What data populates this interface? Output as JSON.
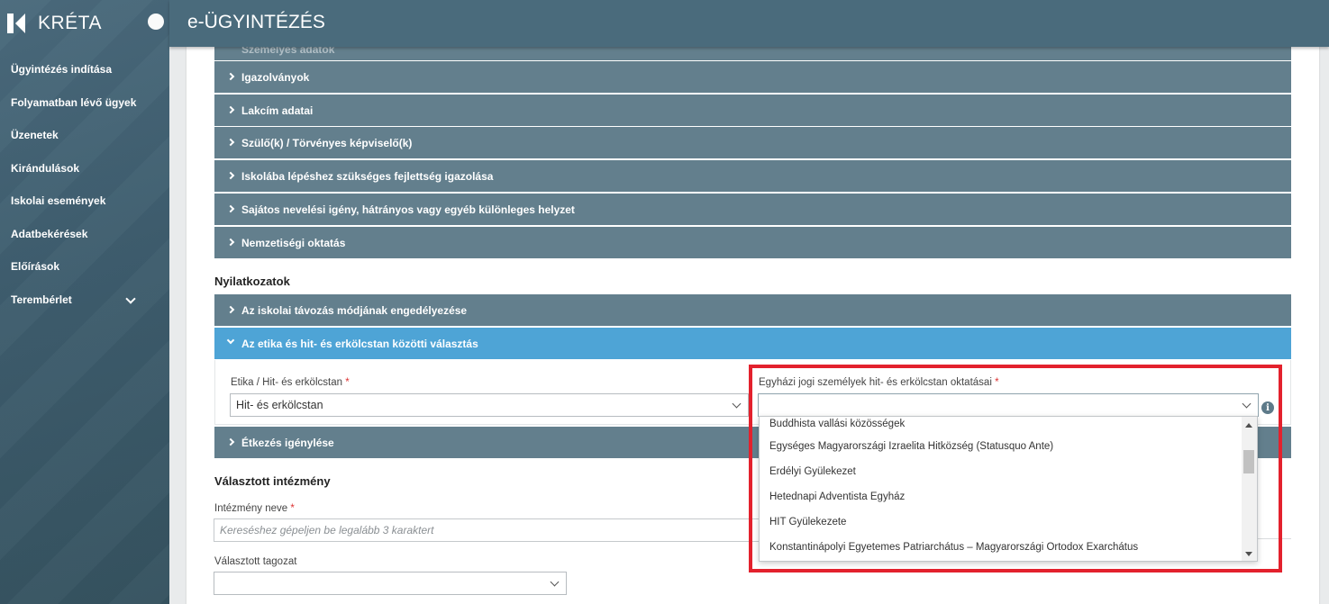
{
  "brand": {
    "name": "KRÉTA"
  },
  "header": {
    "title": "e-ÜGYINTÉZÉS"
  },
  "sidebar": {
    "items": [
      {
        "label": "Ügyintézés indítása"
      },
      {
        "label": "Folyamatban lévő ügyek"
      },
      {
        "label": "Üzenetek"
      },
      {
        "label": "Kirándulások"
      },
      {
        "label": "Iskolai események"
      },
      {
        "label": "Adatbekérések"
      },
      {
        "label": "Előírások"
      },
      {
        "label": "Terembérlet"
      }
    ]
  },
  "accordions_top": [
    "Személyes adatok",
    "Igazolványok",
    "Lakcím adatai",
    "Szülő(k) / Törvényes képviselő(k)",
    "Iskolába lépéshez szükséges fejlettség igazolása",
    "Sajátos nevelési igény, hátrányos vagy egyéb különleges helyzet",
    "Nemzetiségi oktatás"
  ],
  "declarations": {
    "title": "Nyilatkozatok",
    "items": [
      "Az iskolai távozás módjának engedélyezése",
      "Az etika és hit- és erkölcstan közötti választás",
      "Étkezés igénylése"
    ]
  },
  "ethics": {
    "field1_label": "Etika / Hit- és erkölcstan",
    "field1_value": "Hit- és erkölcstan",
    "field2_label": "Egyházi jogi személyek hit- és erkölcstan oktatásai",
    "field2_value": "",
    "required_mark": "*",
    "info_icon": "i"
  },
  "dropdown": {
    "options": [
      "Buddhista vallási közösségek",
      "Egységes Magyarországi Izraelita Hitközség (Statusquo Ante)",
      "Erdélyi Gyülekezet",
      "Hetednapi Adventista Egyház",
      "HIT Gyülekezete",
      "Konstantinápolyi Egyetemes Patriarchátus – Magyarországi Ortodox Exarchátus"
    ]
  },
  "institution": {
    "title": "Választott intézmény",
    "name_label": "Intézmény neve",
    "name_placeholder": "Kereséshez gépeljen be legalább 3 karaktert",
    "branch_label": "Választott tagozat",
    "branch_value": ""
  },
  "colors": {
    "sidebar": "#3e5d6e",
    "accordion": "#637f8d",
    "accordion_open": "#4ea4d6",
    "highlight": "#e3212d"
  }
}
